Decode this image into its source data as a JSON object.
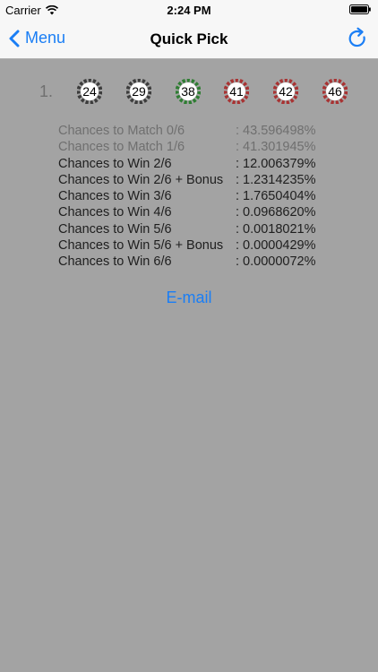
{
  "status_bar": {
    "carrier": "Carrier",
    "time": "2:24 PM"
  },
  "nav": {
    "back_label": "Menu",
    "title": "Quick Pick"
  },
  "pick": {
    "index": "1.",
    "balls": [
      {
        "number": "24",
        "ring": "#3c3c3c"
      },
      {
        "number": "29",
        "ring": "#3c3c3c"
      },
      {
        "number": "38",
        "ring": "#2e7d32"
      },
      {
        "number": "41",
        "ring": "#a83232"
      },
      {
        "number": "42",
        "ring": "#a83232"
      },
      {
        "number": "46",
        "ring": "#a83232"
      }
    ]
  },
  "stats": [
    {
      "label": "Chances to Match 0/6",
      "value": ": 43.596498%",
      "muted": true
    },
    {
      "label": "Chances to Match 1/6",
      "value": ": 41.301945%",
      "muted": true
    },
    {
      "label": "Chances to Win 2/6",
      "value": ": 12.006379%",
      "muted": false
    },
    {
      "label": "Chances to Win 2/6 + Bonus",
      "value": ": 1.2314235%",
      "muted": false
    },
    {
      "label": "Chances to Win 3/6",
      "value": ": 1.7650404%",
      "muted": false
    },
    {
      "label": "Chances to Win 4/6",
      "value": ": 0.0968620%",
      "muted": false
    },
    {
      "label": "Chances to Win 5/6",
      "value": ": 0.0018021%",
      "muted": false
    },
    {
      "label": "Chances to Win 5/6 + Bonus",
      "value": ": 0.0000429%",
      "muted": false
    },
    {
      "label": "Chances to Win 6/6",
      "value": ": 0.0000072%",
      "muted": false
    }
  ],
  "email_label": "E-mail",
  "colors": {
    "accent": "#1a7ef5",
    "background": "#a3a3a3"
  }
}
